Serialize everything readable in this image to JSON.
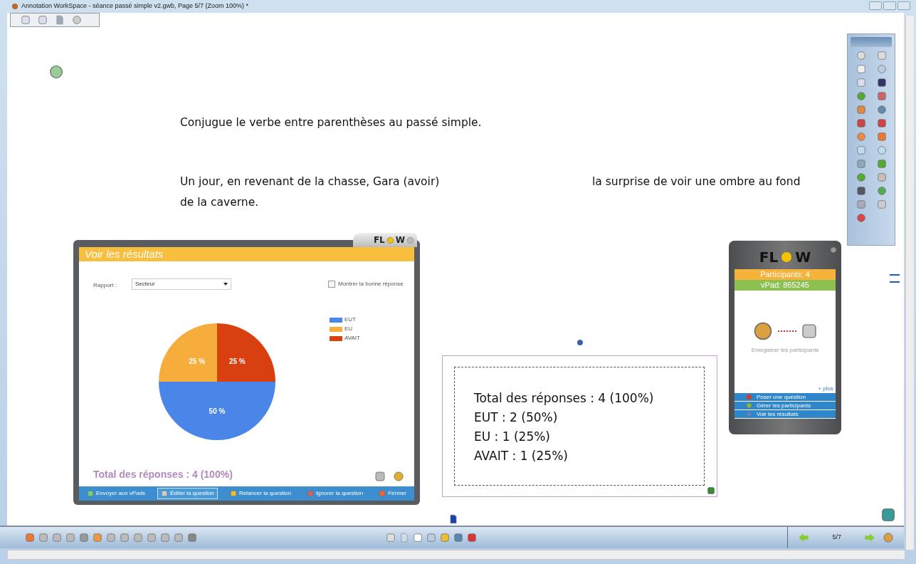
{
  "window": {
    "title": "Annotation WorkSpace - séance passé simple v2.gwb, Page 5/7  (Zoom 100%) *"
  },
  "page": {
    "instruction": "Conjugue le verbe entre parenthèses au passé simple.",
    "sentence_start": "Un jour, en revenant de la chasse, Gara (avoir)",
    "sentence_end": "la surprise de voir une ombre au fond",
    "sentence_cont": "de la caverne."
  },
  "results_window": {
    "logo_left": "FL",
    "logo_right": "W",
    "title": "Voir les résultats",
    "report_label": "Rapport :",
    "report_value": "Secteur",
    "show_answer": {
      "label": "Montrer la bonne réponse",
      "checked": false
    },
    "legend": [
      {
        "color": "#4a86e8"
      },
      {
        "color": "#f6ad3c"
      },
      {
        "color": "#d9400f"
      }
    ],
    "chart_data": {
      "type": "pie",
      "categories": [
        "EUT",
        "EU",
        "AVAIT"
      ],
      "series": [
        {
          "values": [
            50,
            25,
            25
          ]
        }
      ],
      "value_labels": [
        "50 %",
        "25 %",
        "25 %"
      ]
    },
    "total": "Total des réponses : 4 (100%)",
    "buttons": [
      {
        "label": "Envoyer aux vPads",
        "selected": false
      },
      {
        "label": "Éditer la question",
        "selected": true
      },
      {
        "label": "Relancer la question",
        "selected": false
      },
      {
        "label": "Ignorer la question",
        "selected": false
      },
      {
        "label": "Fermer",
        "selected": false
      }
    ]
  },
  "text_box": {
    "lines": [
      "Total des réponses : 4 (100%)",
      "EUT : 2 (50%)",
      "EU : 1 (25%)",
      "AVAIT : 1 (25%)"
    ]
  },
  "flow_panel": {
    "logo_left": "FL",
    "logo_right": "W",
    "participants": "Participants: 4",
    "vpad": "vPad: 865245",
    "register": "Enregistrer les participants",
    "more": "+ plus",
    "menu": [
      "Poser une question",
      "Gérer les participants",
      "Voir les résultats"
    ]
  },
  "navigation": {
    "page": "5/7"
  }
}
